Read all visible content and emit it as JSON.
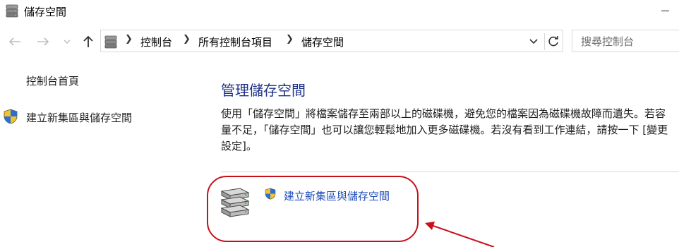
{
  "window": {
    "title": "儲存空間",
    "icon": "storage-spaces-icon"
  },
  "navigation": {
    "back_icon": "back-arrow-icon",
    "forward_icon": "forward-arrow-icon",
    "recent_icon": "chevron-down-icon",
    "up_icon": "up-arrow-icon"
  },
  "address_bar": {
    "breadcrumbs": [
      "控制台",
      "所有控制台項目",
      "儲存空間"
    ],
    "refresh_icon": "refresh-icon",
    "dropdown_icon": "chevron-down-icon"
  },
  "search": {
    "placeholder": "搜尋控制台"
  },
  "left_pane": {
    "home_label": "控制台首頁",
    "create_label": "建立新集區與儲存空間"
  },
  "main": {
    "heading": "管理儲存空間",
    "description": "使用「儲存空間」將檔案儲存至兩部以上的磁碟機，避免您的檔案因為磁碟機故障而遺失。若容量不足，「儲存空間」也可以讓您輕鬆地加入更多磁碟機。若沒有看到工作連結，請按一下 [變更設定]。",
    "task_link_label": "建立新集區與儲存空間"
  },
  "colors": {
    "heading": "#1e3287",
    "link": "#1e4db7",
    "annotation": "#c8101a"
  }
}
